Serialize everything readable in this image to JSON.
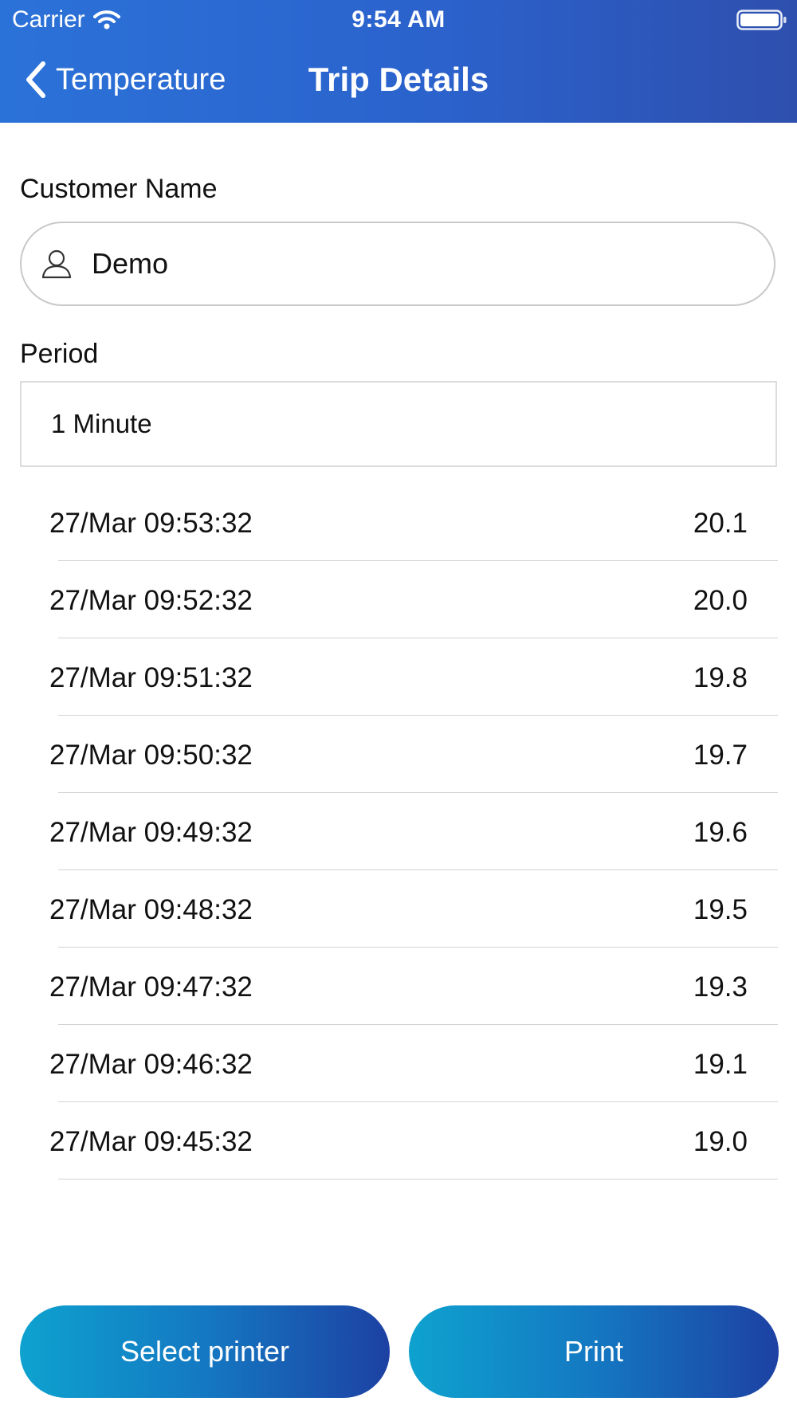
{
  "status_bar": {
    "carrier": "Carrier",
    "time": "9:54 AM",
    "wifi_icon": "wifi-icon",
    "battery_icon": "battery-full-icon"
  },
  "nav": {
    "back_label": "Temperature",
    "title": "Trip Details",
    "back_icon": "chevron-left-icon"
  },
  "form": {
    "customer_label": "Customer Name",
    "customer_value": "Demo",
    "customer_icon": "person-icon",
    "period_label": "Period",
    "period_value": "1 Minute"
  },
  "readings": [
    {
      "time": "27/Mar 09:53:32",
      "value": "20.1"
    },
    {
      "time": "27/Mar 09:52:32",
      "value": "20.0"
    },
    {
      "time": "27/Mar 09:51:32",
      "value": "19.8"
    },
    {
      "time": "27/Mar 09:50:32",
      "value": "19.7"
    },
    {
      "time": "27/Mar 09:49:32",
      "value": "19.6"
    },
    {
      "time": "27/Mar 09:48:32",
      "value": "19.5"
    },
    {
      "time": "27/Mar 09:47:32",
      "value": "19.3"
    },
    {
      "time": "27/Mar 09:46:32",
      "value": "19.1"
    },
    {
      "time": "27/Mar 09:45:32",
      "value": "19.0"
    }
  ],
  "buttons": {
    "select_printer": "Select printer",
    "print": "Print"
  },
  "colors": {
    "header_start": "#2b72d8",
    "header_end": "#2e4fae",
    "button_start": "#0ea2cf",
    "button_end": "#1d41a3"
  }
}
